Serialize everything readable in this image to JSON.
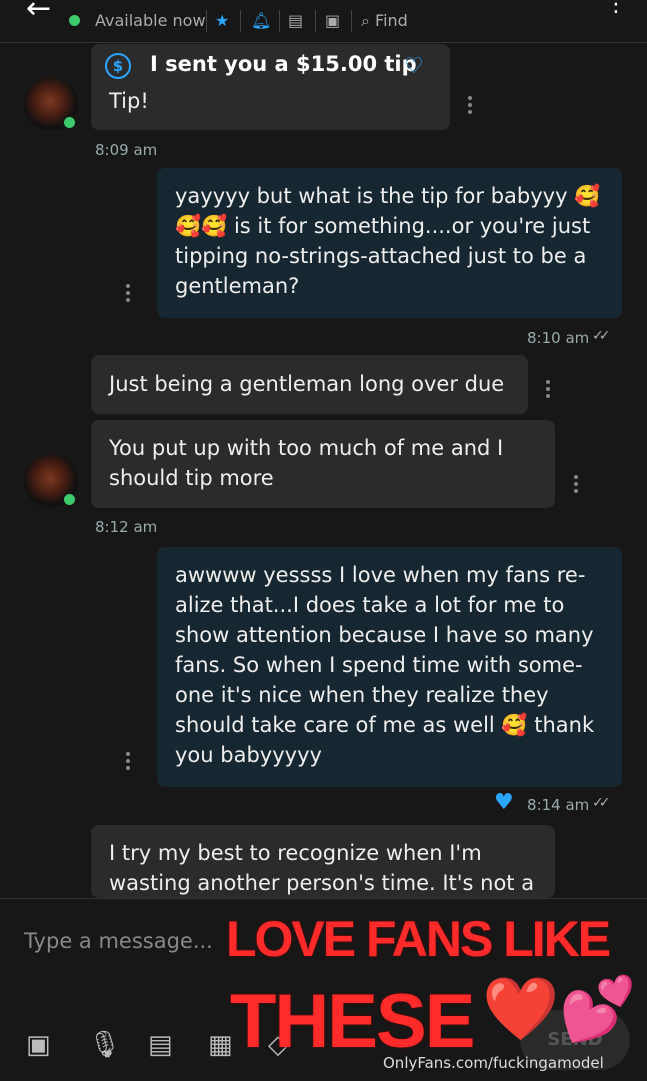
{
  "header": {
    "status": "Available now",
    "find_label": "Find",
    "icons": [
      "back-arrow-icon",
      "star-icon",
      "bell-icon",
      "note-icon",
      "media-icon",
      "search-icon",
      "more-icon"
    ]
  },
  "messages": [
    {
      "from": "them",
      "tip_text": "I sent you a $15.00 tip",
      "body": "Tip!",
      "time": "8:09 am"
    },
    {
      "from": "me",
      "body": "yayyyy but what is the tip for babyyy 🥰🥰🥰 is it for something....or you're just tipping no-strings-attached just to be a gentleman?",
      "time": "8:10 am"
    },
    {
      "from": "them",
      "body": "Just being a gentleman long over due"
    },
    {
      "from": "them",
      "body": "You put up with too much of me and I should tip more",
      "time": "8:12 am"
    },
    {
      "from": "me",
      "body": "awwww yessss I love when my fans re-alize that...I does take a lot for me to show attention because I have so many fans. So when I spend time with some-one it's nice when they realize they should take care of me as well 🥰 thank you babyyyyy",
      "time": "8:14 am"
    },
    {
      "from": "them",
      "body": "I try my best to recognize when I'm wasting another person's time. It's not a"
    }
  ],
  "composer": {
    "placeholder": "Type a message...",
    "send_label": "SEND"
  },
  "overlay": {
    "line1": "LOVE FANS LIKE",
    "line2": "THESE",
    "emoji": "❤️💕"
  },
  "watermark": "OnlyFans.com/fuckingamodel",
  "colors": {
    "accent": "#2aa6ff",
    "online": "#3dca6c",
    "overlay_red": "#ff2a2a"
  }
}
